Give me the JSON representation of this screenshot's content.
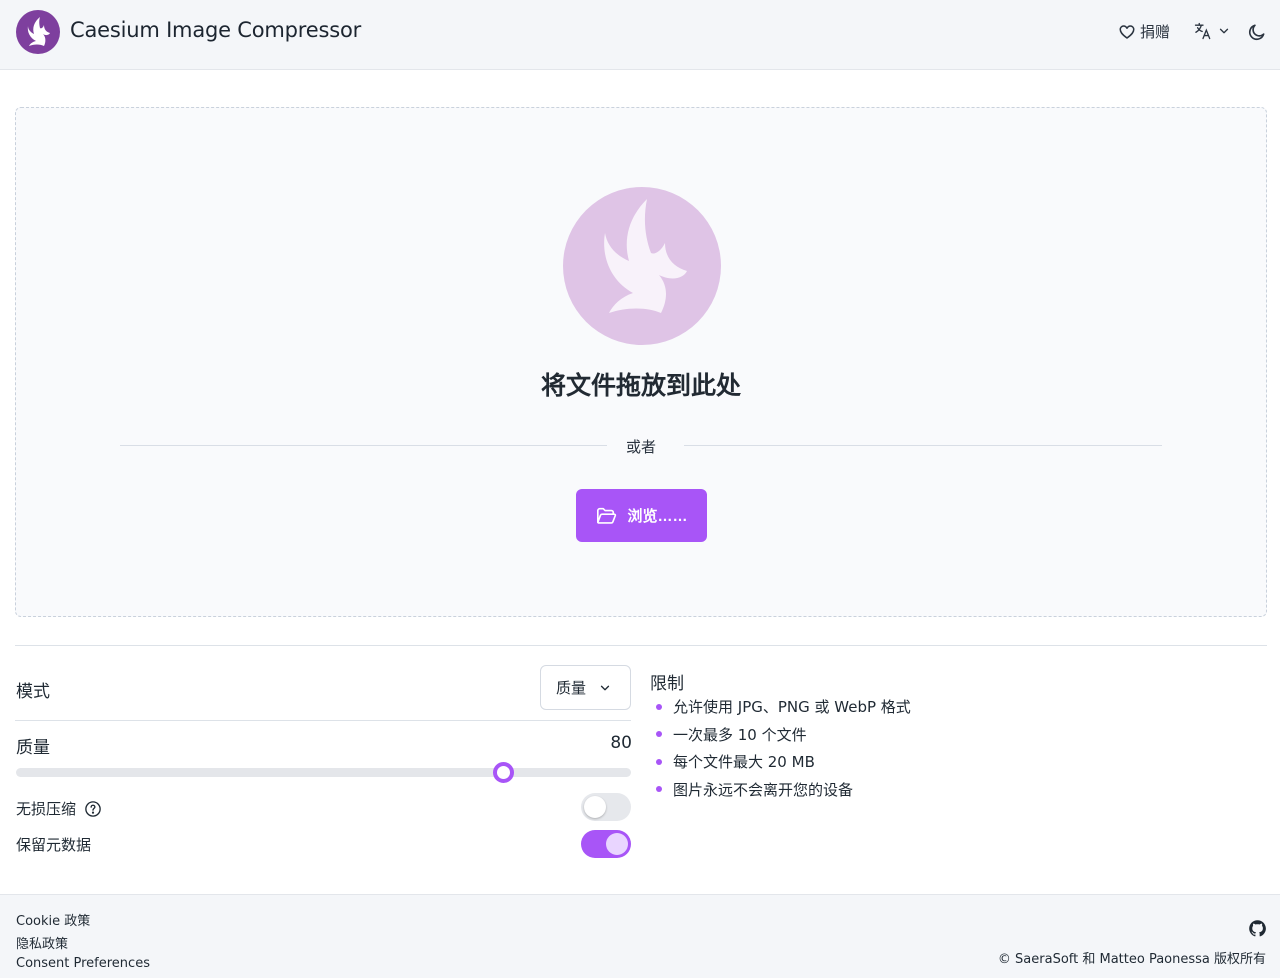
{
  "header": {
    "title": "Caesium Image Compressor",
    "donate_label": "捐赠",
    "icons": {
      "logo": "caesium-logo",
      "donate": "heart-icon",
      "language": "translate-icon",
      "theme": "moon-icon"
    }
  },
  "dropzone": {
    "title": "将文件拖放到此处",
    "or": "或者",
    "browse_label": "浏览……"
  },
  "settings": {
    "mode_label": "模式",
    "mode_value": "质量",
    "quality_label": "质量",
    "quality_value": "80",
    "quality_slider": 80,
    "lossless_label": "无损压缩",
    "lossless_on": false,
    "keep_metadata_label": "保留元数据",
    "keep_metadata_on": true
  },
  "limits": {
    "title": "限制",
    "items": [
      "允许使用 JPG、PNG 或 WebP 格式",
      "一次最多 10 个文件",
      "每个文件最大 20 MB",
      "图片永远不会离开您的设备"
    ]
  },
  "footer": {
    "links": [
      "Cookie 政策",
      "隐私政策",
      "Consent Preferences"
    ],
    "copyright": "© SaeraSoft 和 Matteo Paonessa 版权所有"
  },
  "colors": {
    "accent": "#a855f7",
    "accent_light": "#e9d5ff",
    "logo_bg": "#dfc4e6"
  }
}
